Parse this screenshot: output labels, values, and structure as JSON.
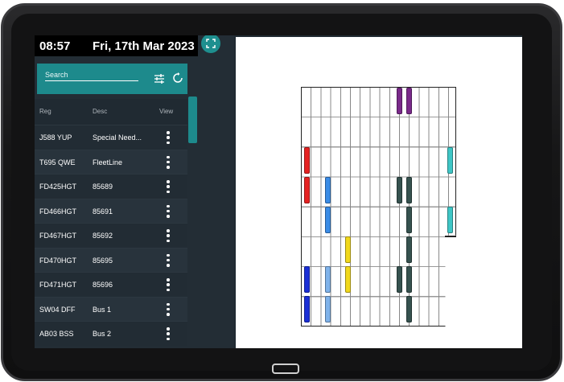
{
  "header": {
    "time": "08:57",
    "date": "Fri, 17th Mar 2023"
  },
  "search": {
    "placeholder": "Search",
    "value": ""
  },
  "table": {
    "columns": [
      "Reg",
      "Desc",
      "View"
    ],
    "rows": [
      {
        "reg": "J588 YUP",
        "desc": "Special Need..."
      },
      {
        "reg": "T695 QWE",
        "desc": "FleetLine"
      },
      {
        "reg": "FD425HGT",
        "desc": "85689"
      },
      {
        "reg": "FD466HGT",
        "desc": "85691"
      },
      {
        "reg": "FD467HGT",
        "desc": "85692"
      },
      {
        "reg": "FD470HGT",
        "desc": "85695"
      },
      {
        "reg": "FD471HGT",
        "desc": "85696"
      },
      {
        "reg": "SW04 DFF",
        "desc": "Bus 1"
      },
      {
        "reg": "AB03 BSS",
        "desc": "Bus 2"
      }
    ]
  },
  "icons": {
    "expand": "expand-icon",
    "filter": "tune-icon",
    "refresh": "refresh-icon",
    "row_action": "more-vert-icon"
  },
  "colors": {
    "accent": "#1d8a8c",
    "panel_bg": "#232d35",
    "bus_purple": "#7a2a8a",
    "bus_red": "#e52222",
    "bus_cyan": "#3fc6c6",
    "bus_blue": "#3b8ce6",
    "bus_light_blue": "#7fb2ea",
    "bus_dark_slate": "#36524f",
    "bus_yellow": "#f1d81c",
    "bus_navy": "#1a2fd6"
  }
}
